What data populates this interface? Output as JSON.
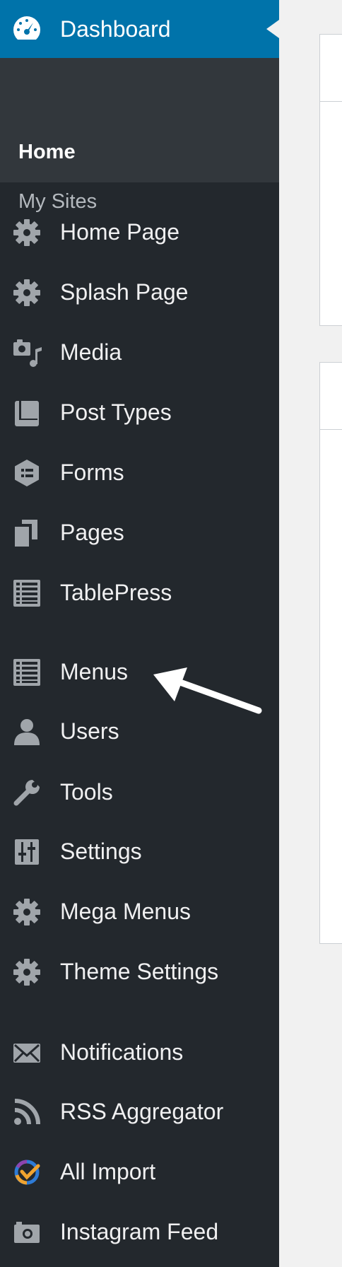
{
  "sidebar": {
    "dashboard": {
      "label": "Dashboard",
      "icon": "dashboard-gauge-icon"
    },
    "submenu": [
      {
        "label": "Home",
        "current": true
      },
      {
        "label": "My Sites",
        "current": false
      }
    ],
    "items": [
      {
        "label": "Home Page",
        "icon": "gear-icon"
      },
      {
        "label": "Splash Page",
        "icon": "gear-icon"
      },
      {
        "label": "Media",
        "icon": "media-icon"
      },
      {
        "label": "Post Types",
        "icon": "book-icon"
      },
      {
        "label": "Forms",
        "icon": "forms-icon"
      },
      {
        "label": "Pages",
        "icon": "pages-icon"
      },
      {
        "label": "TablePress",
        "icon": "table-list-icon"
      },
      {
        "label": "Menus",
        "icon": "list-icon"
      },
      {
        "label": "Users",
        "icon": "user-icon"
      },
      {
        "label": "Tools",
        "icon": "wrench-icon"
      },
      {
        "label": "Settings",
        "icon": "sliders-icon"
      },
      {
        "label": "Mega Menus",
        "icon": "gear-icon"
      },
      {
        "label": "Theme Settings",
        "icon": "gear-icon"
      },
      {
        "label": "Notifications",
        "icon": "envelope-icon"
      },
      {
        "label": "RSS Aggregator",
        "icon": "rss-icon"
      },
      {
        "label": "All Import",
        "icon": "all-import-icon"
      },
      {
        "label": "Instagram Feed",
        "icon": "camera-icon"
      }
    ]
  },
  "colors": {
    "sidebar_bg": "#23282d",
    "submenu_bg": "#32373c",
    "active_bg": "#0073aa",
    "icon": "#a0a5aa",
    "annotation_arrow": "#ffffff"
  }
}
